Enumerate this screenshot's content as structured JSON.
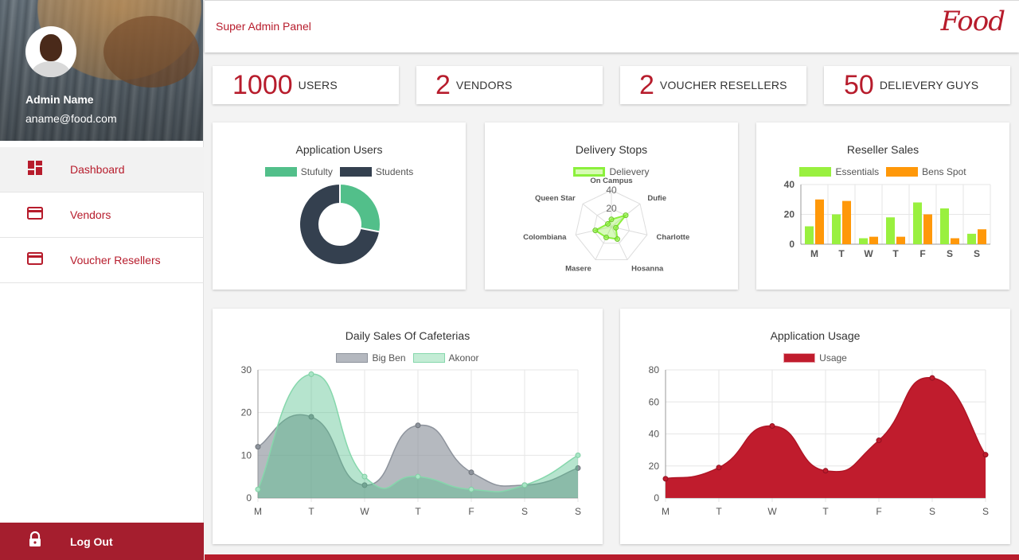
{
  "header": {
    "title": "Super Admin Panel",
    "logo_text": "Food"
  },
  "profile": {
    "name": "Admin Name",
    "email": "aname@food.com"
  },
  "nav": [
    {
      "label": "Dashboard",
      "icon": "dashboard-icon"
    },
    {
      "label": "Vendors",
      "icon": "card-icon"
    },
    {
      "label": "Voucher Resellers",
      "icon": "card-icon"
    }
  ],
  "logout": {
    "label": "Log Out",
    "icon": "lock-icon"
  },
  "stats": [
    {
      "value": "1000",
      "label": "USERS"
    },
    {
      "value": "2",
      "label": "VENDORS"
    },
    {
      "value": "2",
      "label": "VOUCHER RESELLERS"
    },
    {
      "value": "50",
      "label": "DELIEVERY GUYS"
    }
  ],
  "colors": {
    "accent": "#b71c2c",
    "sidebar_footer": "#a51e2e"
  },
  "chart_data": [
    {
      "type": "pie",
      "title": "Application Users",
      "labels": [
        "Stufulty",
        "Students"
      ],
      "values": [
        28,
        72
      ],
      "colors": [
        "#52bf8a",
        "#34404f"
      ],
      "legend": "top"
    },
    {
      "type": "radar",
      "title": "Delivery Stops",
      "categories": [
        "On Campus",
        "Dufie",
        "Charlotte",
        "Hosanna",
        "Masere",
        "Colombiana",
        "Queen Star"
      ],
      "series": [
        {
          "name": "Delievery",
          "values": [
            8,
            20,
            5,
            15,
            13,
            18,
            5
          ]
        }
      ],
      "ticks": [
        "20",
        "40"
      ],
      "rmax": 40,
      "colors": [
        "#8bf03c"
      ]
    },
    {
      "type": "bar",
      "title": "Reseller Sales",
      "categories": [
        "M",
        "T",
        "W",
        "T",
        "F",
        "S",
        "S"
      ],
      "series": [
        {
          "name": "Essentials",
          "values": [
            12,
            20,
            4,
            18,
            28,
            24,
            7
          ],
          "color": "#99f03f"
        },
        {
          "name": "Bens Spot",
          "values": [
            30,
            29,
            5,
            5,
            20,
            4,
            10
          ],
          "color": "#ff9809"
        }
      ],
      "ylim": [
        0,
        40
      ],
      "yticks": [
        "0",
        "20",
        "40"
      ],
      "grid": true
    },
    {
      "type": "area",
      "title": "Daily Sales Of Cafeterias",
      "categories": [
        "M",
        "T",
        "W",
        "T",
        "F",
        "S",
        "S"
      ],
      "series": [
        {
          "name": "Big Ben",
          "values": [
            12,
            19,
            3,
            17,
            6,
            3,
            7
          ],
          "color": "#8d939c"
        },
        {
          "name": "Akonor",
          "values": [
            2,
            29,
            5,
            5,
            2,
            3,
            10
          ],
          "color": "#86d7ac"
        }
      ],
      "ylim": [
        0,
        30
      ],
      "yticks": [
        "0",
        "10",
        "20",
        "30"
      ],
      "grid": true
    },
    {
      "type": "area",
      "title": "Application Usage",
      "categories": [
        "M",
        "T",
        "W",
        "T",
        "F",
        "S",
        "S"
      ],
      "series": [
        {
          "name": "Usage",
          "values": [
            12,
            19,
            45,
            17,
            36,
            75,
            27
          ],
          "color": "#c01c2d"
        }
      ],
      "ylim": [
        0,
        80
      ],
      "yticks": [
        "0",
        "20",
        "40",
        "60",
        "80"
      ],
      "grid": true
    }
  ]
}
